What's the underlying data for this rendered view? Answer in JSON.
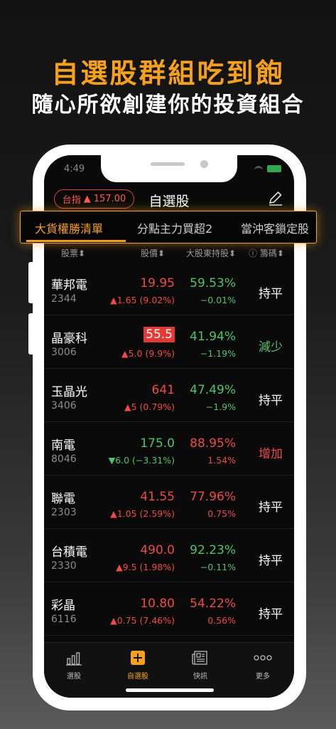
{
  "promo": {
    "headline": "自選股群組吃到飽",
    "subline": "隨心所欲創建你的投資組合"
  },
  "status_bar": {
    "time": "4:49"
  },
  "header": {
    "market_pill": {
      "label": "台指",
      "arrow": "▲",
      "value": "157.00"
    },
    "title": "自選股"
  },
  "group_tabs": [
    {
      "label": "大貨權勝清單",
      "active": true
    },
    {
      "label": "分點主力買超2",
      "active": false
    },
    {
      "label": "當沖客鎖定股",
      "active": false
    }
  ],
  "columns": {
    "stock": "股票⬍",
    "price": "股價⬍",
    "holding": "大股東持股⬍",
    "chips": "ⓘ 籌碼⬍"
  },
  "stocks": [
    {
      "name": "華邦電",
      "code": "2344",
      "price": "19.95",
      "change": "▲1.65 (9.02%)",
      "holding": "59.53%",
      "holding_change": "−0.01%",
      "status": "持平",
      "price_color": "red",
      "change_color": "red",
      "holding_color": "green",
      "holding_change_color": "green",
      "status_color": "white",
      "highlight": false
    },
    {
      "name": "晶豪科",
      "code": "3006",
      "price": "55.5",
      "change": "▲5.0 (9.9%)",
      "holding": "41.94%",
      "holding_change": "−1.19%",
      "status": "減少",
      "price_color": "red",
      "change_color": "red",
      "holding_color": "green",
      "holding_change_color": "green",
      "status_color": "green",
      "highlight": true
    },
    {
      "name": "玉晶光",
      "code": "3406",
      "price": "641",
      "change": "▲5 (0.79%)",
      "holding": "47.49%",
      "holding_change": "−1.9%",
      "status": "持平",
      "price_color": "red",
      "change_color": "red",
      "holding_color": "green",
      "holding_change_color": "green",
      "status_color": "white",
      "highlight": false
    },
    {
      "name": "南電",
      "code": "8046",
      "price": "175.0",
      "change": "▼6.0 (−3.31%)",
      "holding": "88.95%",
      "holding_change": "1.54%",
      "status": "增加",
      "price_color": "green",
      "change_color": "green",
      "holding_color": "red",
      "holding_change_color": "red",
      "status_color": "red",
      "highlight": false
    },
    {
      "name": "聯電",
      "code": "2303",
      "price": "41.55",
      "change": "▲1.05 (2.59%)",
      "holding": "77.96%",
      "holding_change": "0.75%",
      "status": "持平",
      "price_color": "red",
      "change_color": "red",
      "holding_color": "red",
      "holding_change_color": "red",
      "status_color": "white",
      "highlight": false
    },
    {
      "name": "台積電",
      "code": "2330",
      "price": "490.0",
      "change": "▲9.5 (1.98%)",
      "holding": "92.23%",
      "holding_change": "−0.11%",
      "status": "持平",
      "price_color": "red",
      "change_color": "red",
      "holding_color": "green",
      "holding_change_color": "green",
      "status_color": "white",
      "highlight": false
    },
    {
      "name": "彩晶",
      "code": "6116",
      "price": "10.80",
      "change": "▲0.75 (7.46%)",
      "holding": "54.22%",
      "holding_change": "0.56%",
      "status": "持平",
      "price_color": "red",
      "change_color": "red",
      "holding_color": "red",
      "holding_change_color": "red",
      "status_color": "white",
      "highlight": false
    }
  ],
  "bottom_tabs": [
    {
      "label": "選股",
      "icon": "bar-chart-icon",
      "active": false
    },
    {
      "label": "自選股",
      "icon": "plus-square-icon",
      "active": true
    },
    {
      "label": "快訊",
      "icon": "newspaper-icon",
      "active": false
    },
    {
      "label": "更多",
      "icon": "more-dots-icon",
      "active": false
    }
  ],
  "colors": {
    "accent": "#f6a11e",
    "up": "#ef4b45",
    "down": "#4fc46a",
    "background": "#0a0a0a"
  }
}
